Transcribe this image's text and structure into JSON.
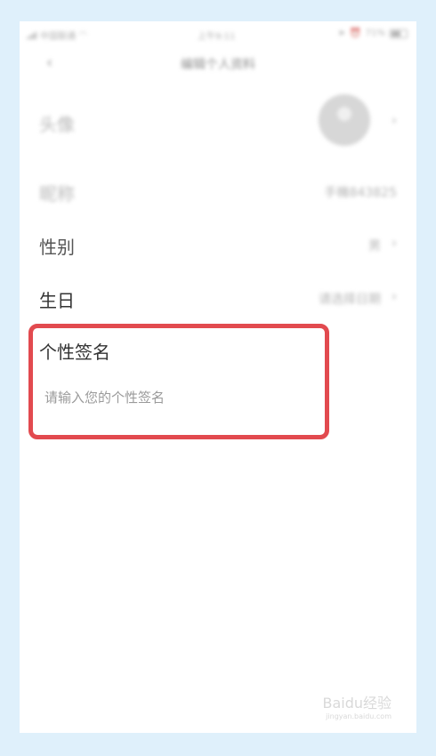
{
  "status_bar": {
    "carrier": "中国联通",
    "time": "上午9:11",
    "battery": "71%"
  },
  "nav": {
    "title": "编辑个人资料"
  },
  "rows": {
    "avatar": {
      "label": "头像"
    },
    "nickname": {
      "label": "昵称",
      "value": "手機843825"
    },
    "gender": {
      "label": "性别",
      "value": "男"
    },
    "birthday": {
      "label": "生日",
      "value": "请选择日期"
    }
  },
  "signature": {
    "label": "个性签名",
    "placeholder": "请输入您的个性签名"
  },
  "watermark": {
    "brand": "Baidu经验",
    "url": "jingyan.baidu.com"
  },
  "colors": {
    "highlight": "#e24a4f",
    "background": "#dff0fb"
  }
}
